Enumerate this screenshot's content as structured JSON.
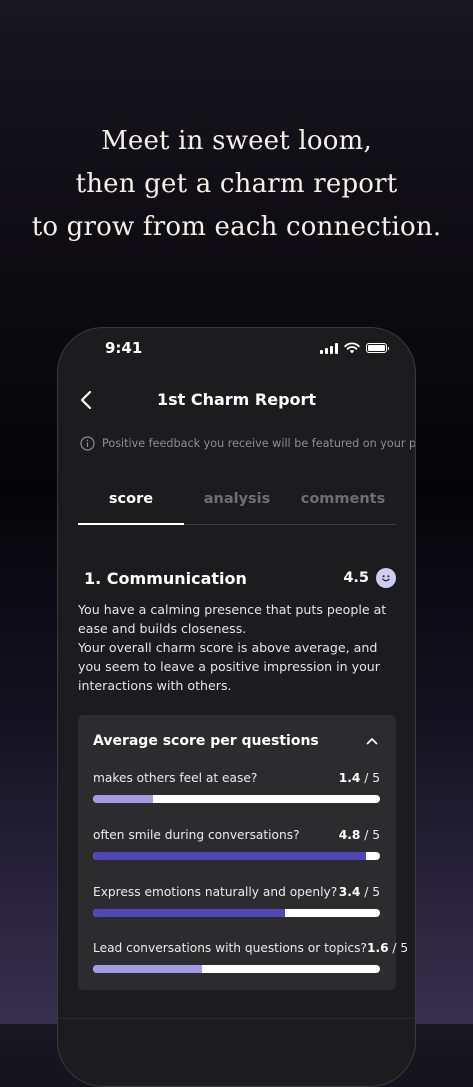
{
  "headline": {
    "line1": "Meet in sweet loom,",
    "line2": "then get a charm report",
    "line3": "to grow from each connection."
  },
  "status": {
    "time": "9:41",
    "icons": [
      "signal-icon",
      "wifi-icon",
      "battery-icon"
    ]
  },
  "nav": {
    "back_icon": "chevron-left-icon",
    "title": "1st Charm Report"
  },
  "info": {
    "icon": "info-icon",
    "text": "Positive feedback you receive will be featured on your profile."
  },
  "tabs": [
    {
      "label": "score",
      "active": true
    },
    {
      "label": "analysis",
      "active": false
    },
    {
      "label": "comments",
      "active": false
    }
  ],
  "section": {
    "title": "1. Communication",
    "score": "4.5",
    "score_icon": "smile-icon",
    "description": [
      "You have a calming presence that puts people at ease and builds closeness.",
      "Your overall charm score is above average, and you seem to leave a positive impression in your interactions with others."
    ]
  },
  "card": {
    "title": "Average score per questions",
    "toggle_icon": "chevron-up-icon",
    "max_label": " / 5",
    "questions": [
      {
        "text": "makes others feel at ease?",
        "score": "1.4",
        "fill_fraction": 0.21,
        "color": "#a49ae6"
      },
      {
        "text": "often smile during conversations?",
        "score": "4.8",
        "fill_fraction": 0.95,
        "color": "#5146b8"
      },
      {
        "text": "Express emotions naturally and openly?",
        "score": "3.4",
        "fill_fraction": 0.67,
        "color": "#5146b8"
      },
      {
        "text": "Lead conversations with questions or topics?",
        "score": "1.6",
        "fill_fraction": 0.38,
        "color": "#a49ae6"
      }
    ]
  },
  "colors": {
    "accent_dark": "#5146b8",
    "accent_light": "#a49ae6",
    "smile_bg": "#cfcbf3"
  }
}
